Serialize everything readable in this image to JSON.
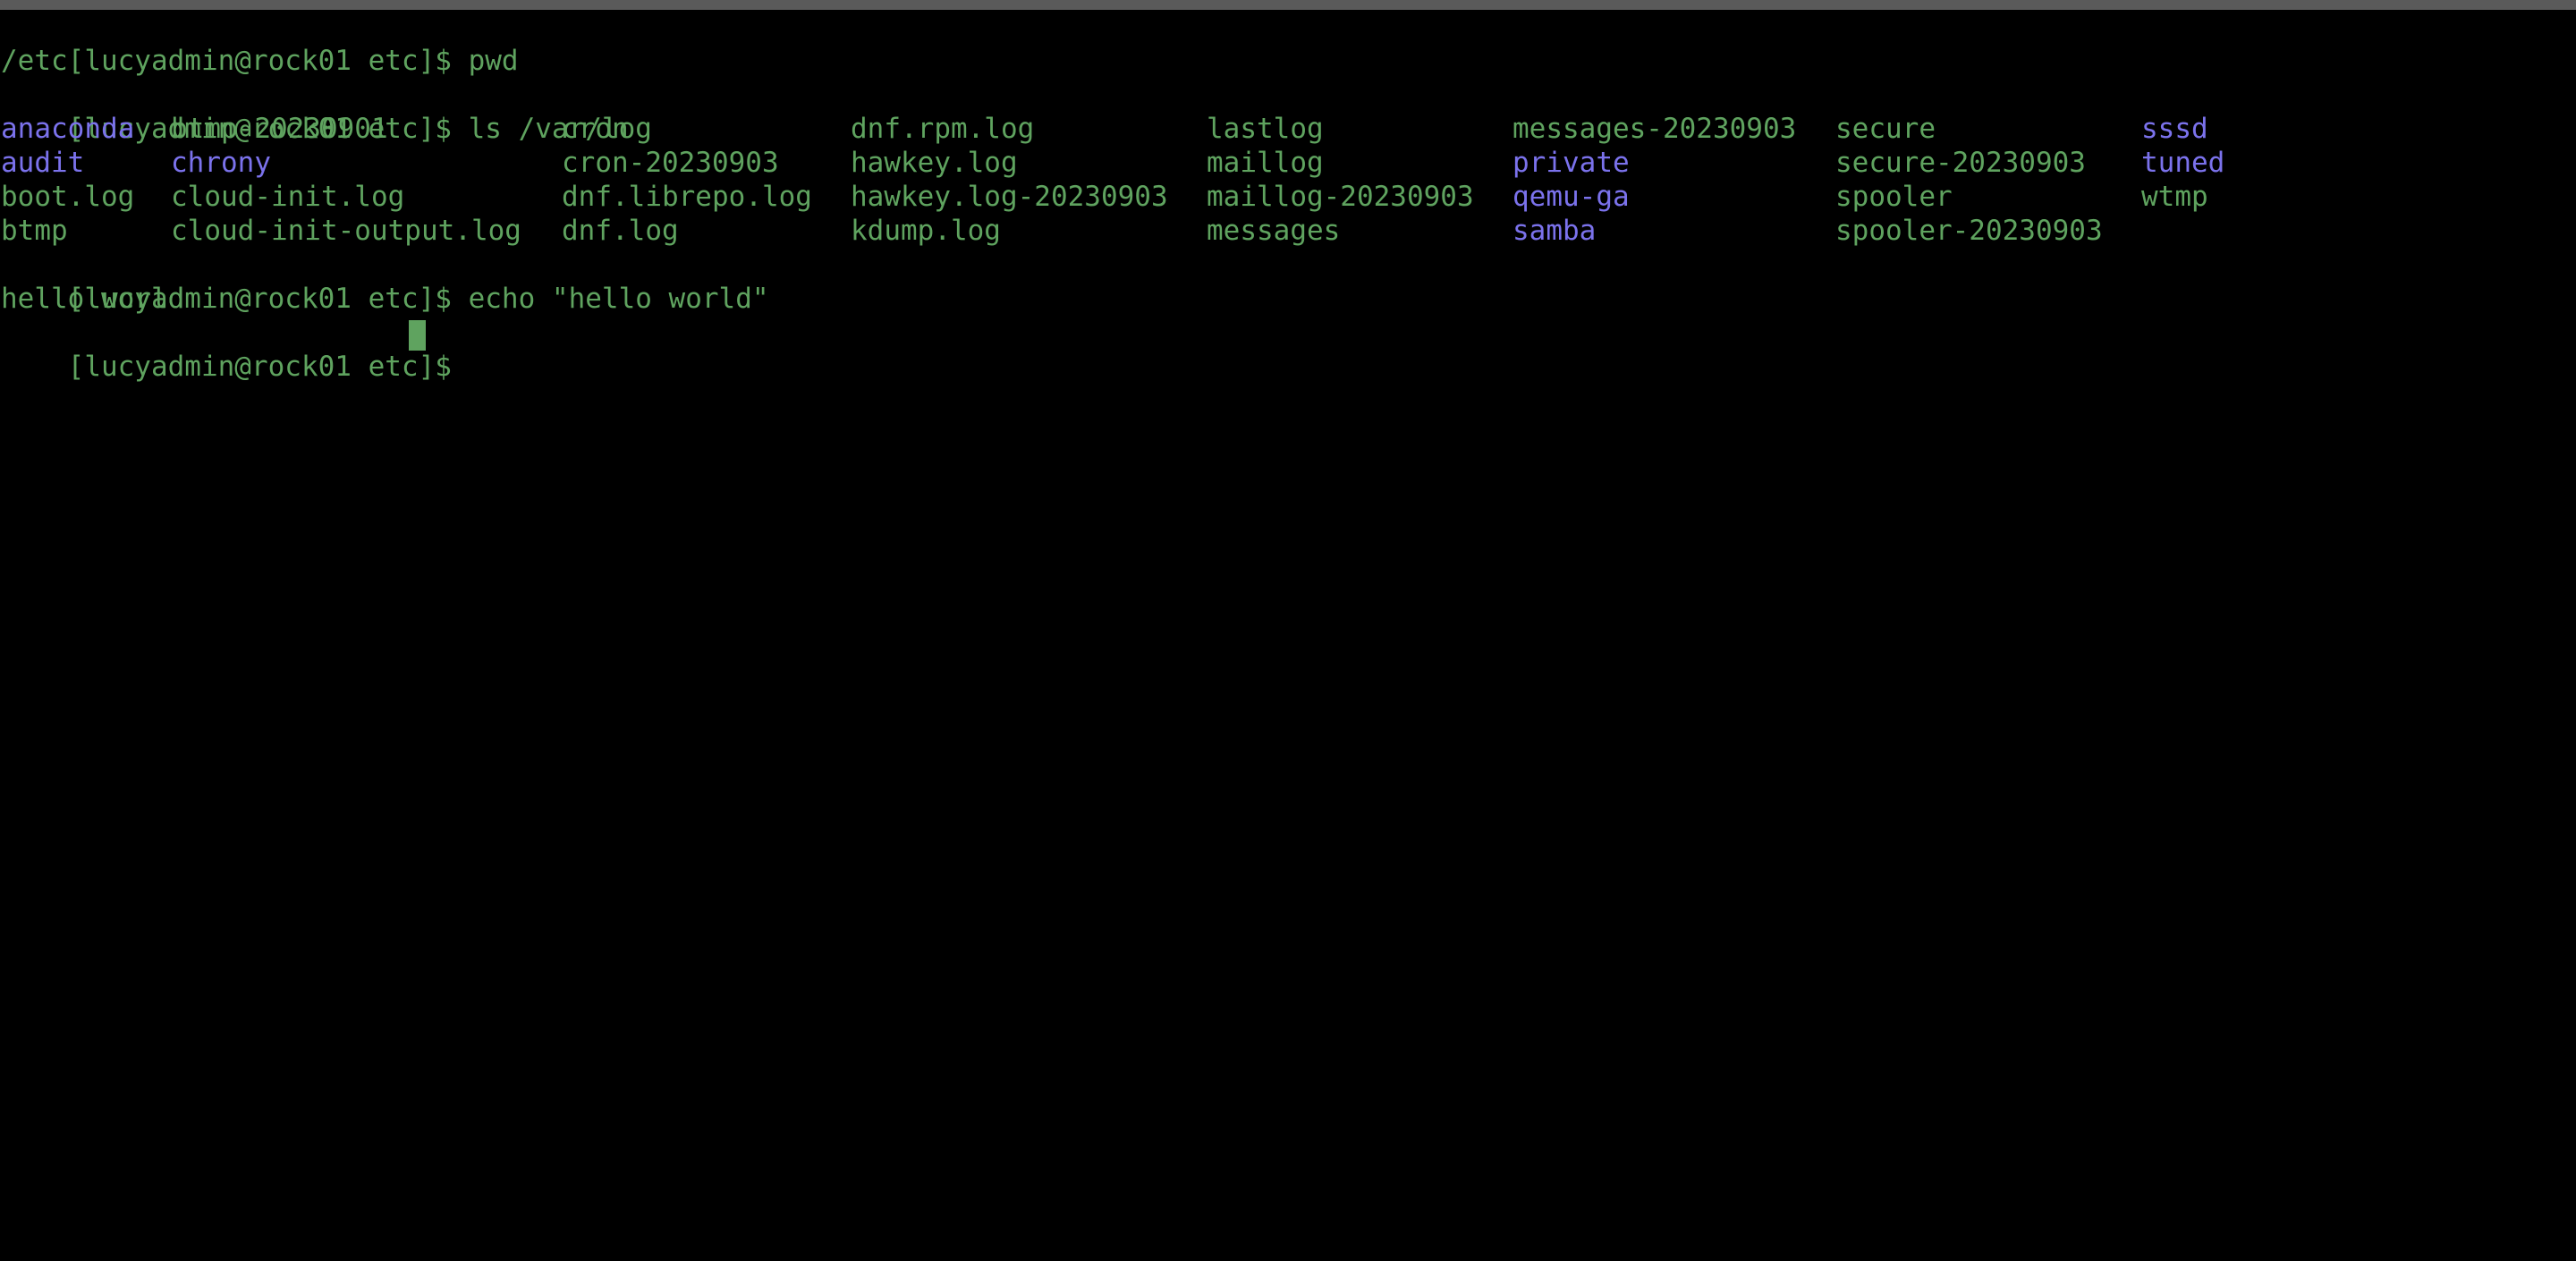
{
  "terminal": {
    "prompt": "[lucyadmin@rock01 etc]$",
    "commands": {
      "pwd": "pwd",
      "ls": "ls /var/log",
      "echo": "echo \"hello world\""
    },
    "outputs": {
      "pwd": "/etc",
      "echo": "hello world"
    },
    "ls_rows": [
      [
        {
          "text": "anaconda",
          "kind": "dir"
        },
        {
          "text": "btmp-20230901",
          "kind": "file"
        },
        {
          "text": "cron",
          "kind": "file"
        },
        {
          "text": "dnf.rpm.log",
          "kind": "file"
        },
        {
          "text": "lastlog",
          "kind": "file"
        },
        {
          "text": "messages-20230903",
          "kind": "file"
        },
        {
          "text": "secure",
          "kind": "file"
        },
        {
          "text": "sssd",
          "kind": "dir"
        }
      ],
      [
        {
          "text": "audit",
          "kind": "dir"
        },
        {
          "text": "chrony",
          "kind": "dir"
        },
        {
          "text": "cron-20230903",
          "kind": "file"
        },
        {
          "text": "hawkey.log",
          "kind": "file"
        },
        {
          "text": "maillog",
          "kind": "file"
        },
        {
          "text": "private",
          "kind": "dir"
        },
        {
          "text": "secure-20230903",
          "kind": "file"
        },
        {
          "text": "tuned",
          "kind": "dir"
        }
      ],
      [
        {
          "text": "boot.log",
          "kind": "file"
        },
        {
          "text": "cloud-init.log",
          "kind": "file"
        },
        {
          "text": "dnf.librepo.log",
          "kind": "file"
        },
        {
          "text": "hawkey.log-20230903",
          "kind": "file"
        },
        {
          "text": "maillog-20230903",
          "kind": "file"
        },
        {
          "text": "qemu-ga",
          "kind": "dir"
        },
        {
          "text": "spooler",
          "kind": "file"
        },
        {
          "text": "wtmp",
          "kind": "file"
        }
      ],
      [
        {
          "text": "btmp",
          "kind": "file"
        },
        {
          "text": "cloud-init-output.log",
          "kind": "file"
        },
        {
          "text": "dnf.log",
          "kind": "file"
        },
        {
          "text": "kdump.log",
          "kind": "file"
        },
        {
          "text": "messages",
          "kind": "file"
        },
        {
          "text": "samba",
          "kind": "dir"
        },
        {
          "text": "spooler-20230903",
          "kind": "file"
        }
      ]
    ],
    "colors": {
      "background": "#000000",
      "text": "#5fa35f",
      "directory": "#7b72ec",
      "cursor": "#5fa35f"
    }
  }
}
